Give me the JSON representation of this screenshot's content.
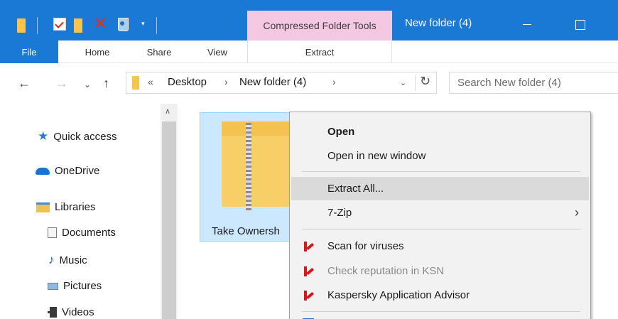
{
  "quick_access_toolbar": {
    "icons": [
      "folder-icon",
      "properties-icon",
      "new-folder-icon",
      "delete-icon",
      "recycle-bin-icon",
      "chevron-down-icon"
    ],
    "delete_glyph": "✕",
    "dropdown_glyph": "▾"
  },
  "title_bar": {
    "contextual_tab_header": "Compressed Folder Tools",
    "window_title": "New folder (4)",
    "accent_color": "#1a79d5",
    "contextual_color": "#f4c7e2"
  },
  "ribbon": {
    "tabs": [
      {
        "label": "File"
      },
      {
        "label": "Home"
      },
      {
        "label": "Share"
      },
      {
        "label": "View"
      },
      {
        "label": "Extract"
      }
    ]
  },
  "address_bar": {
    "back_glyph": "←",
    "forward_glyph": "→",
    "recent_glyph": "⌄",
    "up_glyph": "↑",
    "overflow_glyph": "«",
    "path": [
      "Desktop",
      "New folder (4)"
    ],
    "chevron_glyph": "›",
    "dropdown_glyph": "⌄",
    "refresh_glyph": "↻"
  },
  "search": {
    "placeholder": "Search New folder (4)"
  },
  "nav_pane": {
    "items": [
      {
        "label": "Quick access",
        "icon": "star-icon"
      },
      {
        "label": "OneDrive",
        "icon": "cloud-icon"
      },
      {
        "label": "Libraries",
        "icon": "libraries-icon"
      },
      {
        "label": "Documents",
        "icon": "documents-icon"
      },
      {
        "label": "Music",
        "icon": "music-icon"
      },
      {
        "label": "Pictures",
        "icon": "pictures-icon"
      },
      {
        "label": "Videos",
        "icon": "videos-icon"
      }
    ],
    "star_glyph": "★",
    "music_glyph": "♪",
    "scroll_up_glyph": "∧"
  },
  "content": {
    "selected_file": {
      "name": "Take Ownersh",
      "icon": "zip-folder-icon"
    }
  },
  "context_menu": {
    "items": [
      {
        "label": "Open",
        "style": "bold"
      },
      {
        "label": "Open in new window"
      },
      {
        "label": "Extract All...",
        "state": "hovered"
      },
      {
        "label": "7-Zip",
        "submenu": true
      },
      {
        "label": "Scan for viruses",
        "icon": "kaspersky-icon"
      },
      {
        "label": "Check reputation in KSN",
        "icon": "kaspersky-icon",
        "state": "disabled"
      },
      {
        "label": "Kaspersky Application Advisor",
        "icon": "kaspersky-icon"
      }
    ],
    "submenu_glyph": "›"
  }
}
